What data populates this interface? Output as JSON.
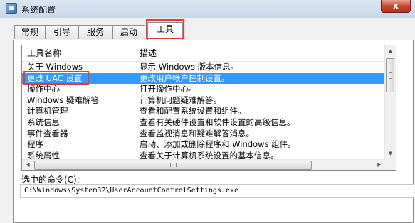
{
  "window": {
    "title": "系统配置",
    "close_label": "x"
  },
  "tabs": [
    {
      "label": "常规"
    },
    {
      "label": "引导"
    },
    {
      "label": "服务"
    },
    {
      "label": "启动"
    },
    {
      "label": "工具"
    }
  ],
  "active_tab": "工具",
  "accent": {
    "highlight_red": "#e23c3c",
    "selection_blue": "#3399ff"
  },
  "tools_list": {
    "columns": [
      "工具名称",
      "描述"
    ],
    "rows": [
      {
        "name": "关于 Windows",
        "description": "显示 Windows 版本信息。"
      },
      {
        "name": "更改 UAC 设置",
        "description": "更改用户帐户控制设置。",
        "selected": true
      },
      {
        "name": "操作中心",
        "description": "打开操作中心。"
      },
      {
        "name": "Windows 疑难解答",
        "description": "计算机问题疑难解答。"
      },
      {
        "name": "计算机管理",
        "description": "查看和配置系统设置和组件。"
      },
      {
        "name": "系统信息",
        "description": "查看有关硬件设置和软件设置的高级信息。"
      },
      {
        "name": "事件查看器",
        "description": "查看监视消息和疑难解答消息。"
      },
      {
        "name": "程序",
        "description": "启动、添加或删除程序和 Windows 组件。"
      },
      {
        "name": "系统属性",
        "description": "查看关于计算机系统设置的基本信息。"
      }
    ]
  },
  "selected_command": {
    "label": "选中的命令(C):",
    "value": "C:\\Windows\\System32\\UserAccountControlSettings.exe"
  }
}
